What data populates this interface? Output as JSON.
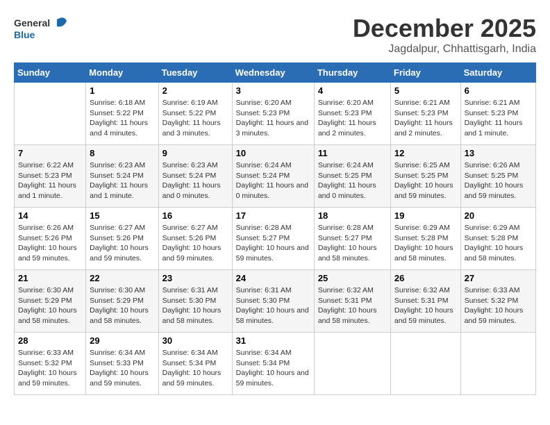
{
  "header": {
    "logo_general": "General",
    "logo_blue": "Blue",
    "month_title": "December 2025",
    "location": "Jagdalpur, Chhattisgarh, India"
  },
  "columns": [
    "Sunday",
    "Monday",
    "Tuesday",
    "Wednesday",
    "Thursday",
    "Friday",
    "Saturday"
  ],
  "weeks": [
    [
      {
        "day": "",
        "sunrise": "",
        "sunset": "",
        "daylight": ""
      },
      {
        "day": "1",
        "sunrise": "Sunrise: 6:18 AM",
        "sunset": "Sunset: 5:22 PM",
        "daylight": "Daylight: 11 hours and 4 minutes."
      },
      {
        "day": "2",
        "sunrise": "Sunrise: 6:19 AM",
        "sunset": "Sunset: 5:22 PM",
        "daylight": "Daylight: 11 hours and 3 minutes."
      },
      {
        "day": "3",
        "sunrise": "Sunrise: 6:20 AM",
        "sunset": "Sunset: 5:23 PM",
        "daylight": "Daylight: 11 hours and 3 minutes."
      },
      {
        "day": "4",
        "sunrise": "Sunrise: 6:20 AM",
        "sunset": "Sunset: 5:23 PM",
        "daylight": "Daylight: 11 hours and 2 minutes."
      },
      {
        "day": "5",
        "sunrise": "Sunrise: 6:21 AM",
        "sunset": "Sunset: 5:23 PM",
        "daylight": "Daylight: 11 hours and 2 minutes."
      },
      {
        "day": "6",
        "sunrise": "Sunrise: 6:21 AM",
        "sunset": "Sunset: 5:23 PM",
        "daylight": "Daylight: 11 hours and 1 minute."
      }
    ],
    [
      {
        "day": "7",
        "sunrise": "Sunrise: 6:22 AM",
        "sunset": "Sunset: 5:23 PM",
        "daylight": "Daylight: 11 hours and 1 minute."
      },
      {
        "day": "8",
        "sunrise": "Sunrise: 6:23 AM",
        "sunset": "Sunset: 5:24 PM",
        "daylight": "Daylight: 11 hours and 1 minute."
      },
      {
        "day": "9",
        "sunrise": "Sunrise: 6:23 AM",
        "sunset": "Sunset: 5:24 PM",
        "daylight": "Daylight: 11 hours and 0 minutes."
      },
      {
        "day": "10",
        "sunrise": "Sunrise: 6:24 AM",
        "sunset": "Sunset: 5:24 PM",
        "daylight": "Daylight: 11 hours and 0 minutes."
      },
      {
        "day": "11",
        "sunrise": "Sunrise: 6:24 AM",
        "sunset": "Sunset: 5:25 PM",
        "daylight": "Daylight: 11 hours and 0 minutes."
      },
      {
        "day": "12",
        "sunrise": "Sunrise: 6:25 AM",
        "sunset": "Sunset: 5:25 PM",
        "daylight": "Daylight: 10 hours and 59 minutes."
      },
      {
        "day": "13",
        "sunrise": "Sunrise: 6:26 AM",
        "sunset": "Sunset: 5:25 PM",
        "daylight": "Daylight: 10 hours and 59 minutes."
      }
    ],
    [
      {
        "day": "14",
        "sunrise": "Sunrise: 6:26 AM",
        "sunset": "Sunset: 5:26 PM",
        "daylight": "Daylight: 10 hours and 59 minutes."
      },
      {
        "day": "15",
        "sunrise": "Sunrise: 6:27 AM",
        "sunset": "Sunset: 5:26 PM",
        "daylight": "Daylight: 10 hours and 59 minutes."
      },
      {
        "day": "16",
        "sunrise": "Sunrise: 6:27 AM",
        "sunset": "Sunset: 5:26 PM",
        "daylight": "Daylight: 10 hours and 59 minutes."
      },
      {
        "day": "17",
        "sunrise": "Sunrise: 6:28 AM",
        "sunset": "Sunset: 5:27 PM",
        "daylight": "Daylight: 10 hours and 59 minutes."
      },
      {
        "day": "18",
        "sunrise": "Sunrise: 6:28 AM",
        "sunset": "Sunset: 5:27 PM",
        "daylight": "Daylight: 10 hours and 58 minutes."
      },
      {
        "day": "19",
        "sunrise": "Sunrise: 6:29 AM",
        "sunset": "Sunset: 5:28 PM",
        "daylight": "Daylight: 10 hours and 58 minutes."
      },
      {
        "day": "20",
        "sunrise": "Sunrise: 6:29 AM",
        "sunset": "Sunset: 5:28 PM",
        "daylight": "Daylight: 10 hours and 58 minutes."
      }
    ],
    [
      {
        "day": "21",
        "sunrise": "Sunrise: 6:30 AM",
        "sunset": "Sunset: 5:29 PM",
        "daylight": "Daylight: 10 hours and 58 minutes."
      },
      {
        "day": "22",
        "sunrise": "Sunrise: 6:30 AM",
        "sunset": "Sunset: 5:29 PM",
        "daylight": "Daylight: 10 hours and 58 minutes."
      },
      {
        "day": "23",
        "sunrise": "Sunrise: 6:31 AM",
        "sunset": "Sunset: 5:30 PM",
        "daylight": "Daylight: 10 hours and 58 minutes."
      },
      {
        "day": "24",
        "sunrise": "Sunrise: 6:31 AM",
        "sunset": "Sunset: 5:30 PM",
        "daylight": "Daylight: 10 hours and 58 minutes."
      },
      {
        "day": "25",
        "sunrise": "Sunrise: 6:32 AM",
        "sunset": "Sunset: 5:31 PM",
        "daylight": "Daylight: 10 hours and 58 minutes."
      },
      {
        "day": "26",
        "sunrise": "Sunrise: 6:32 AM",
        "sunset": "Sunset: 5:31 PM",
        "daylight": "Daylight: 10 hours and 59 minutes."
      },
      {
        "day": "27",
        "sunrise": "Sunrise: 6:33 AM",
        "sunset": "Sunset: 5:32 PM",
        "daylight": "Daylight: 10 hours and 59 minutes."
      }
    ],
    [
      {
        "day": "28",
        "sunrise": "Sunrise: 6:33 AM",
        "sunset": "Sunset: 5:32 PM",
        "daylight": "Daylight: 10 hours and 59 minutes."
      },
      {
        "day": "29",
        "sunrise": "Sunrise: 6:34 AM",
        "sunset": "Sunset: 5:33 PM",
        "daylight": "Daylight: 10 hours and 59 minutes."
      },
      {
        "day": "30",
        "sunrise": "Sunrise: 6:34 AM",
        "sunset": "Sunset: 5:34 PM",
        "daylight": "Daylight: 10 hours and 59 minutes."
      },
      {
        "day": "31",
        "sunrise": "Sunrise: 6:34 AM",
        "sunset": "Sunset: 5:34 PM",
        "daylight": "Daylight: 10 hours and 59 minutes."
      },
      {
        "day": "",
        "sunrise": "",
        "sunset": "",
        "daylight": ""
      },
      {
        "day": "",
        "sunrise": "",
        "sunset": "",
        "daylight": ""
      },
      {
        "day": "",
        "sunrise": "",
        "sunset": "",
        "daylight": ""
      }
    ]
  ]
}
